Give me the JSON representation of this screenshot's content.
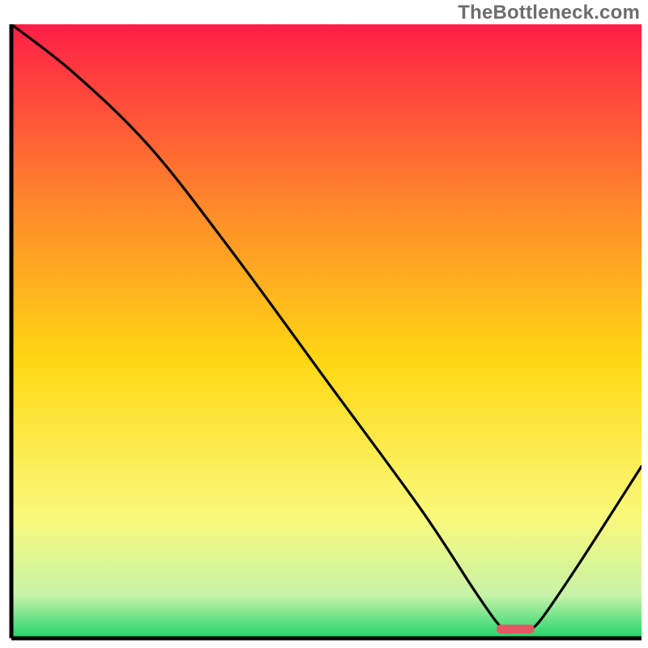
{
  "watermark": {
    "text": "TheBottleneck.com"
  },
  "colors": {
    "stroke": "#000000",
    "marker_fill": "#e15a63",
    "axis": "#000000",
    "gradient_top": "#ff1f46",
    "gradient_upper_mid": "#ff8a2a",
    "gradient_mid": "#ffd814",
    "gradient_lower_mid": "#faf97a",
    "gradient_near_bottom": "#c7f3a8",
    "gradient_bottom": "#1fd36b"
  },
  "chart_data": {
    "type": "line",
    "title": "",
    "xlabel": "",
    "ylabel": "",
    "xlim": [
      0,
      100
    ],
    "ylim": [
      0,
      100
    ],
    "legend": false,
    "grid": false,
    "marker": {
      "x_start": 77,
      "x_end": 83,
      "y": 1.5,
      "shape": "rounded-bar"
    },
    "series": [
      {
        "name": "curve",
        "x": [
          0,
          10,
          22,
          35,
          50,
          65,
          74,
          78,
          80,
          82,
          84,
          90,
          100
        ],
        "y": [
          100,
          92,
          80,
          63,
          42,
          21,
          7,
          1.5,
          1.2,
          1.5,
          3,
          12,
          28
        ]
      }
    ]
  }
}
